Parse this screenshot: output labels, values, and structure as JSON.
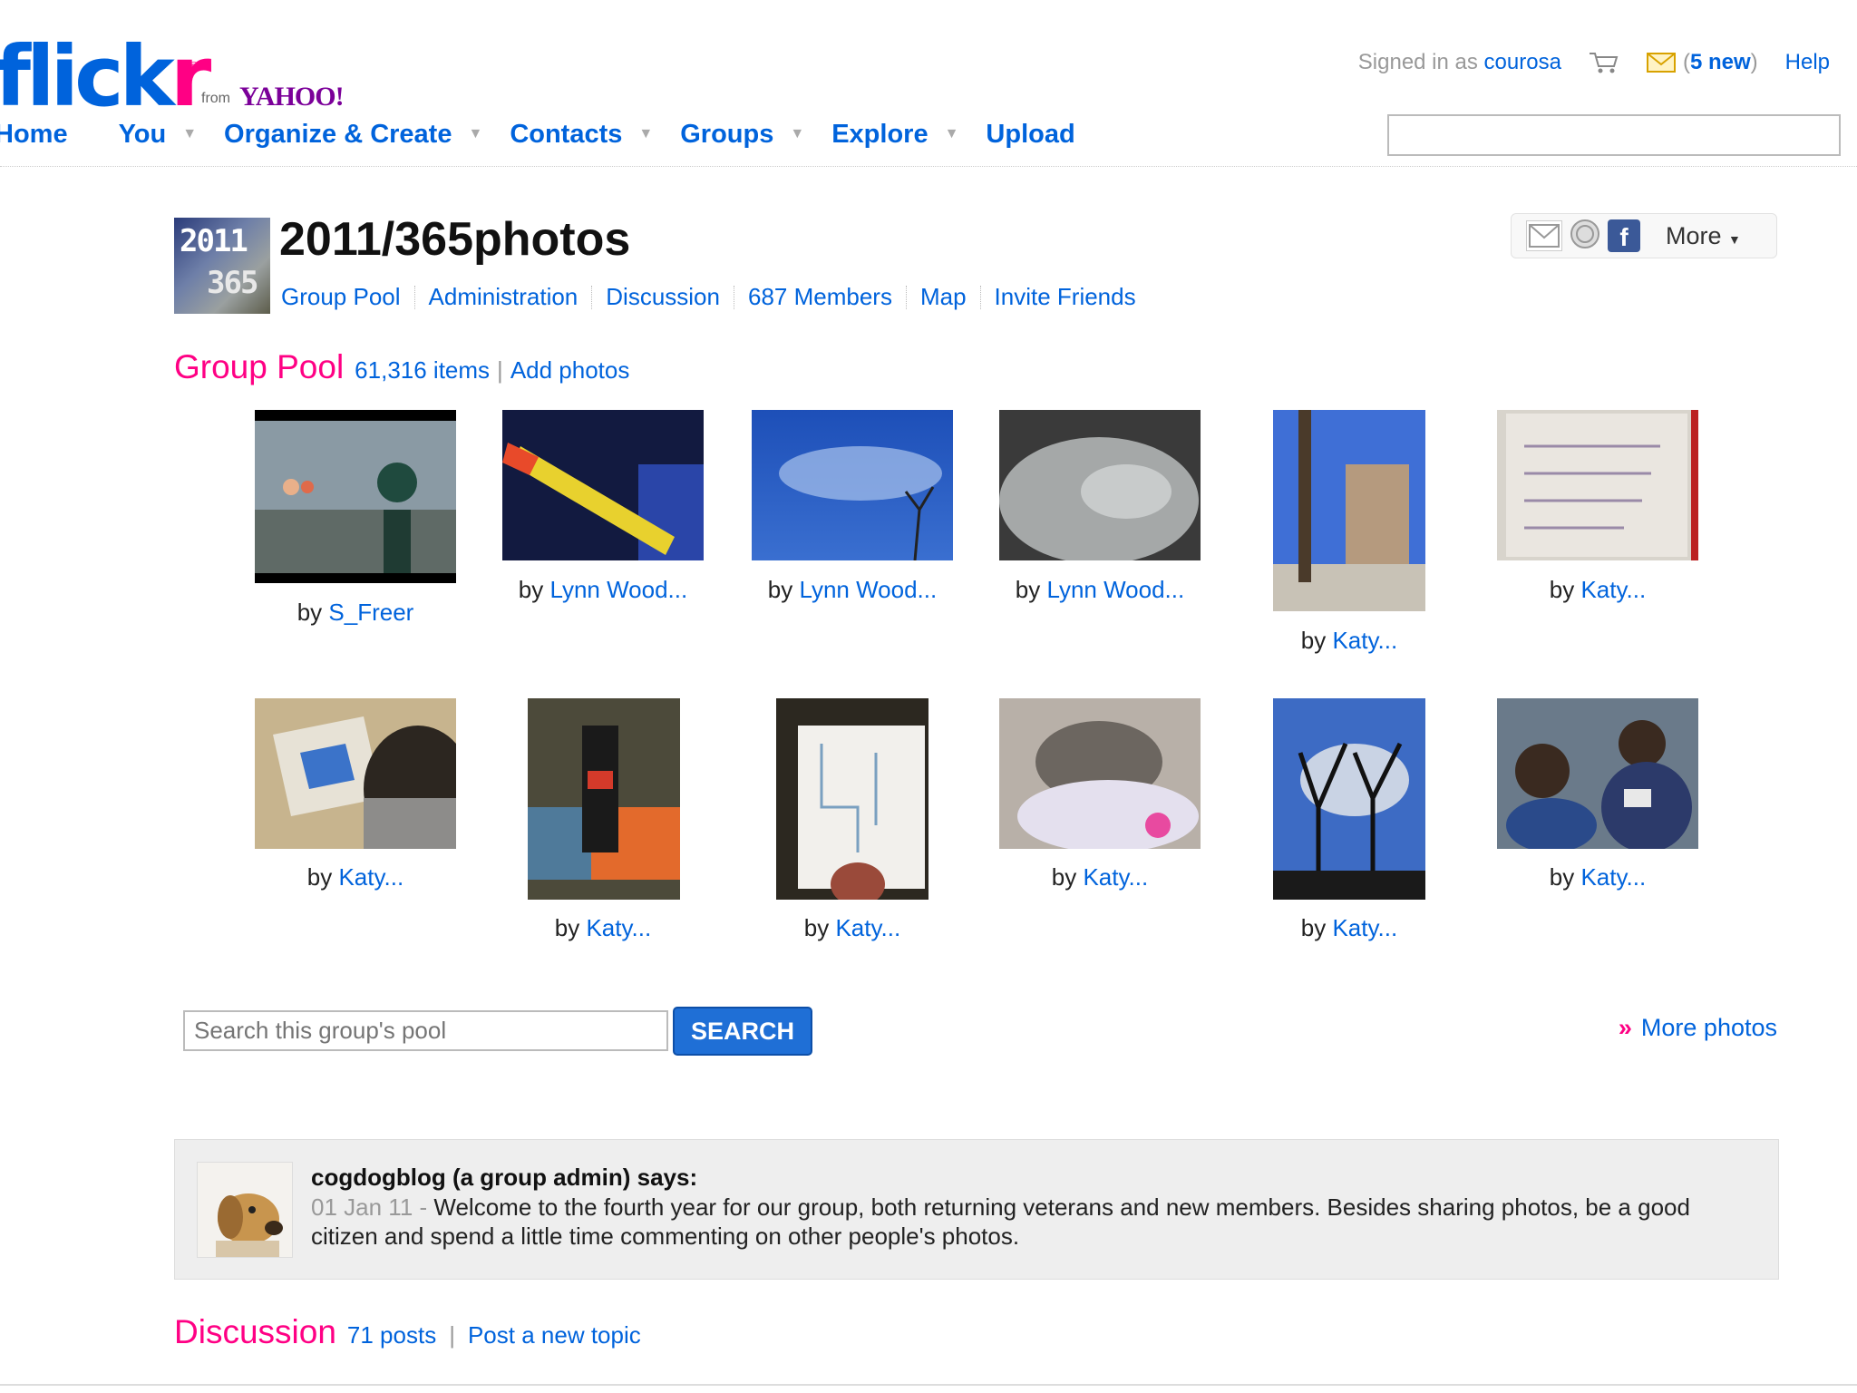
{
  "header": {
    "logo_text": "flickr",
    "logo_from": "from",
    "logo_yahoo": "YAHOO!",
    "signed_in_prefix": "Signed in as",
    "username": "courosa",
    "mail_open": "(",
    "mail_count": "5 new",
    "mail_close": ")",
    "help": "Help",
    "search_value": ""
  },
  "nav": [
    {
      "label": "Home"
    },
    {
      "label": "You"
    },
    {
      "label": "Organize & Create"
    },
    {
      "label": "Contacts"
    },
    {
      "label": "Groups"
    },
    {
      "label": "Explore"
    },
    {
      "label": "Upload"
    }
  ],
  "group": {
    "title": "2011/365photos",
    "icon_text": "2011 365",
    "tabs": [
      "Group Pool",
      "Administration",
      "Discussion",
      "687 Members",
      "Map",
      "Invite Friends"
    ],
    "more_label": "More"
  },
  "pool": {
    "heading": "Group Pool",
    "count": "61,316 items",
    "add": "Add photos",
    "by": "by",
    "photos": [
      {
        "author": "S_Freer"
      },
      {
        "author": "Lynn Wood..."
      },
      {
        "author": "Lynn Wood..."
      },
      {
        "author": "Lynn Wood..."
      },
      {
        "author": "Katy..."
      },
      {
        "author": "Katy..."
      },
      {
        "author": "Katy..."
      },
      {
        "author": "Katy..."
      },
      {
        "author": "Katy..."
      },
      {
        "author": "Katy..."
      },
      {
        "author": "Katy..."
      },
      {
        "author": "Katy..."
      }
    ],
    "search_placeholder": "Search this group's pool",
    "search_button": "SEARCH",
    "more_photos": "More photos"
  },
  "admin": {
    "name": "cogdogblog (a group admin) says:",
    "date": "01 Jan 11 -",
    "message": "Welcome to the fourth year for our group, both returning veterans and new members. Besides sharing photos, be a good citizen and spend a little time commenting on other people's photos."
  },
  "discussion": {
    "heading": "Discussion",
    "count": "71 posts",
    "new_topic": "Post a new topic"
  }
}
